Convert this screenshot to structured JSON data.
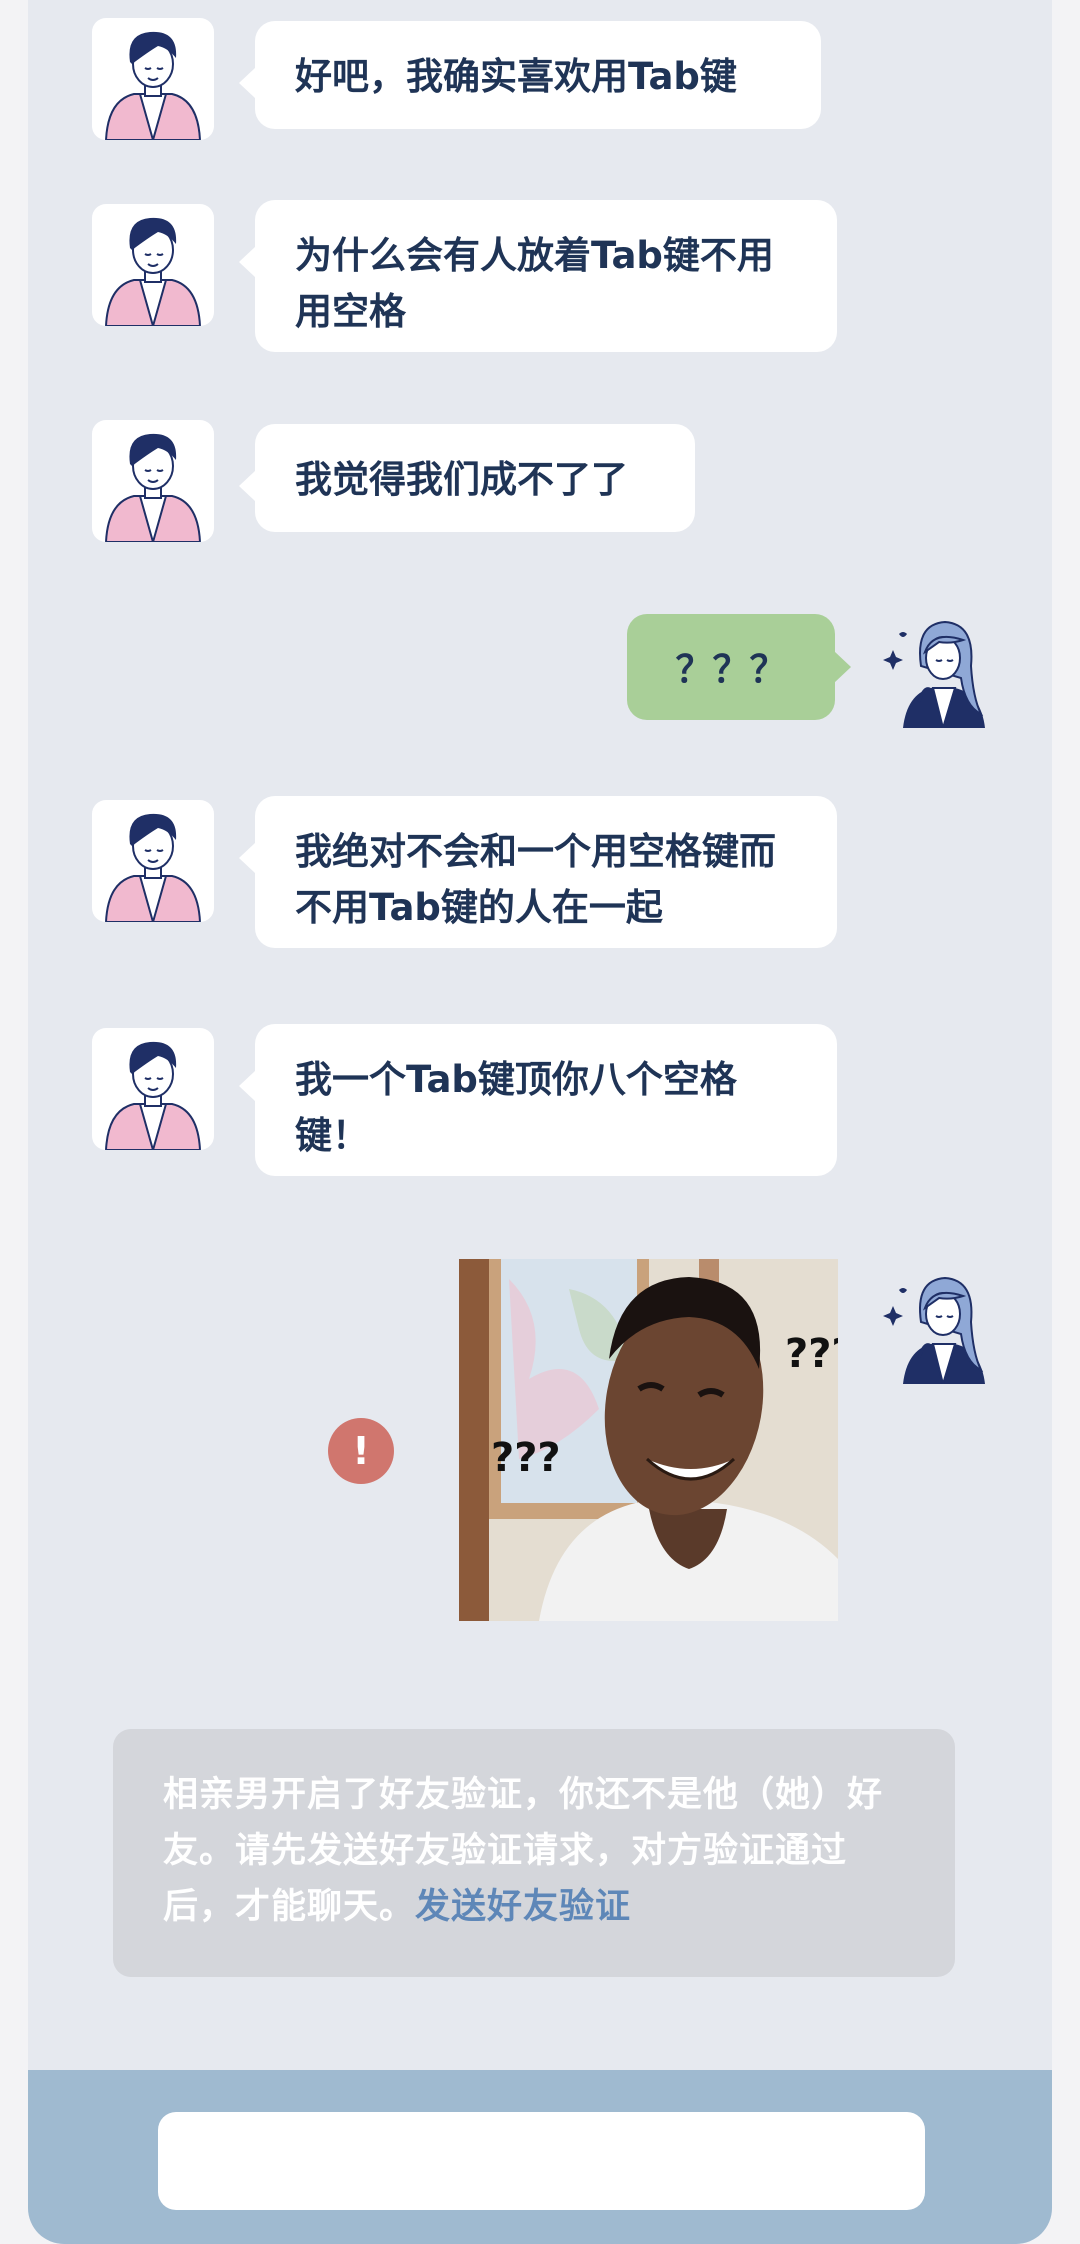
{
  "messages": [
    {
      "side": "left",
      "text": "好吧，我确实喜欢用Tab键"
    },
    {
      "side": "left",
      "text": "为什么会有人放着Tab键不用用空格"
    },
    {
      "side": "left",
      "text": "我觉得我们成不了了"
    },
    {
      "side": "right",
      "text": "？？？"
    },
    {
      "side": "left",
      "text": "我绝对不会和一个用空格键而不用Tab键的人在一起"
    },
    {
      "side": "left",
      "text": "我一个Tab键顶你八个空格键！"
    }
  ],
  "meme": {
    "label_left": "???",
    "label_right": "???"
  },
  "error_icon": "!",
  "notice": {
    "text": "相亲男开启了好友验证，你还不是他（她）好友。请先发送好友验证请求，对方验证通过后，才能聊天。",
    "link": "发送好友验证"
  },
  "colors": {
    "background": "#e6e9ef",
    "bubble_left": "#ffffff",
    "bubble_right": "#a9cf98",
    "text": "#1f3456",
    "error": "#d0766e",
    "link": "#5e87b8",
    "footer": "#9fbad0"
  },
  "icons": {
    "male_avatar": "male-avatar-icon",
    "female_avatar": "female-avatar-icon",
    "error": "error-icon"
  }
}
